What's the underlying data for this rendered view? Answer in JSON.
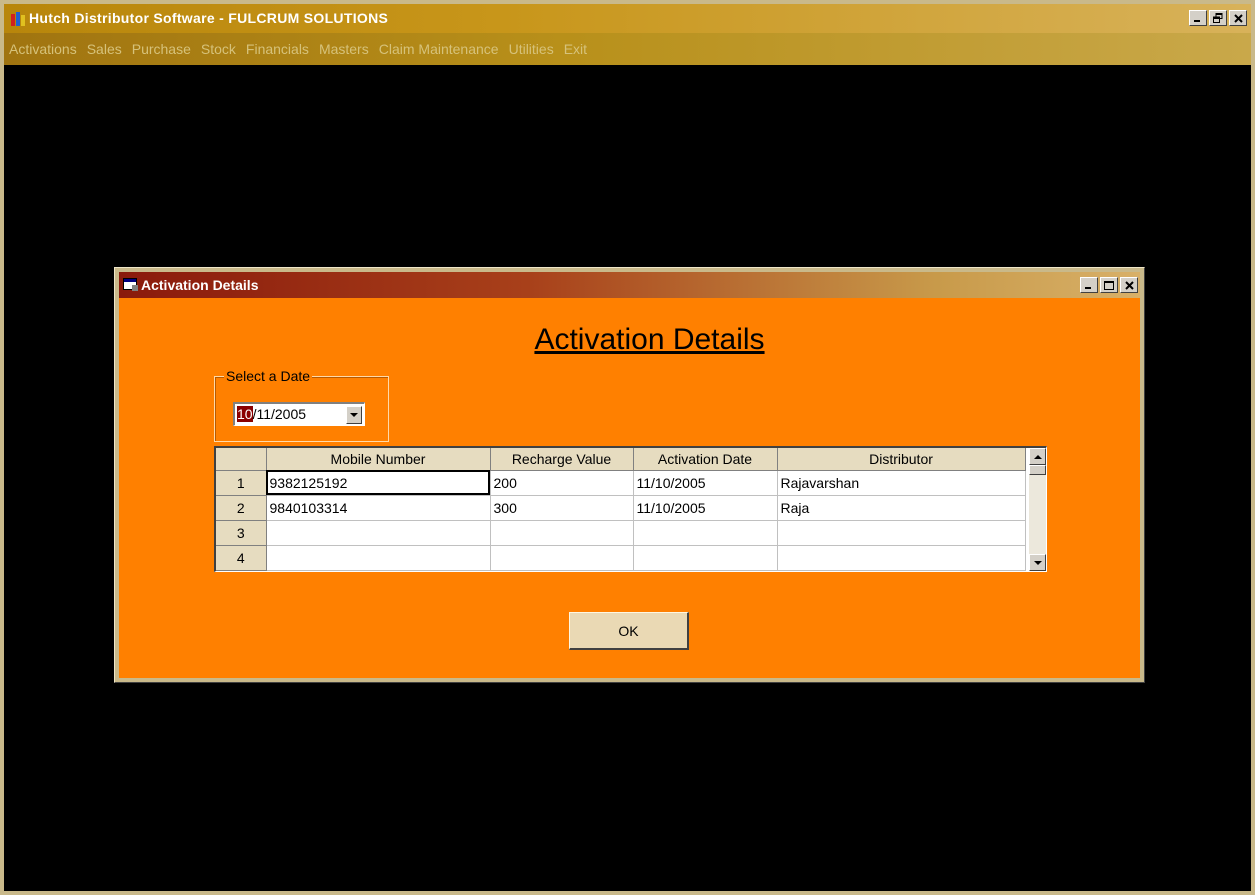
{
  "app": {
    "title": "Hutch Distributor Software - FULCRUM SOLUTIONS",
    "window_buttons": [
      "minimize",
      "restore",
      "close"
    ],
    "menu": [
      "Activations",
      "Sales",
      "Purchase",
      "Stock",
      "Financials",
      "Masters",
      "Claim Maintenance",
      "Utilities",
      "Exit"
    ]
  },
  "dialog": {
    "title": "Activation Details",
    "heading": "Activation Details",
    "date_group_label": "Select a Date",
    "date_day": "10",
    "date_rest": "/11/2005",
    "grid": {
      "columns": [
        "Mobile Number",
        "Recharge Value",
        "Activation Date",
        "Distributor"
      ],
      "rows": [
        {
          "num": "1",
          "mobile": "9382125192",
          "recharge": "200",
          "date": "11/10/2005",
          "distributor": "Rajavarshan"
        },
        {
          "num": "2",
          "mobile": "9840103314",
          "recharge": "300",
          "date": "11/10/2005",
          "distributor": "Raja"
        },
        {
          "num": "3",
          "mobile": "",
          "recharge": "",
          "date": "",
          "distributor": ""
        },
        {
          "num": "4",
          "mobile": "",
          "recharge": "",
          "date": "",
          "distributor": ""
        }
      ]
    },
    "ok_label": "OK"
  },
  "colors": {
    "dialog_body": "#ff8000",
    "app_title_gradient": "#b8860b",
    "dialog_title_gradient": "#8a1a0c"
  }
}
